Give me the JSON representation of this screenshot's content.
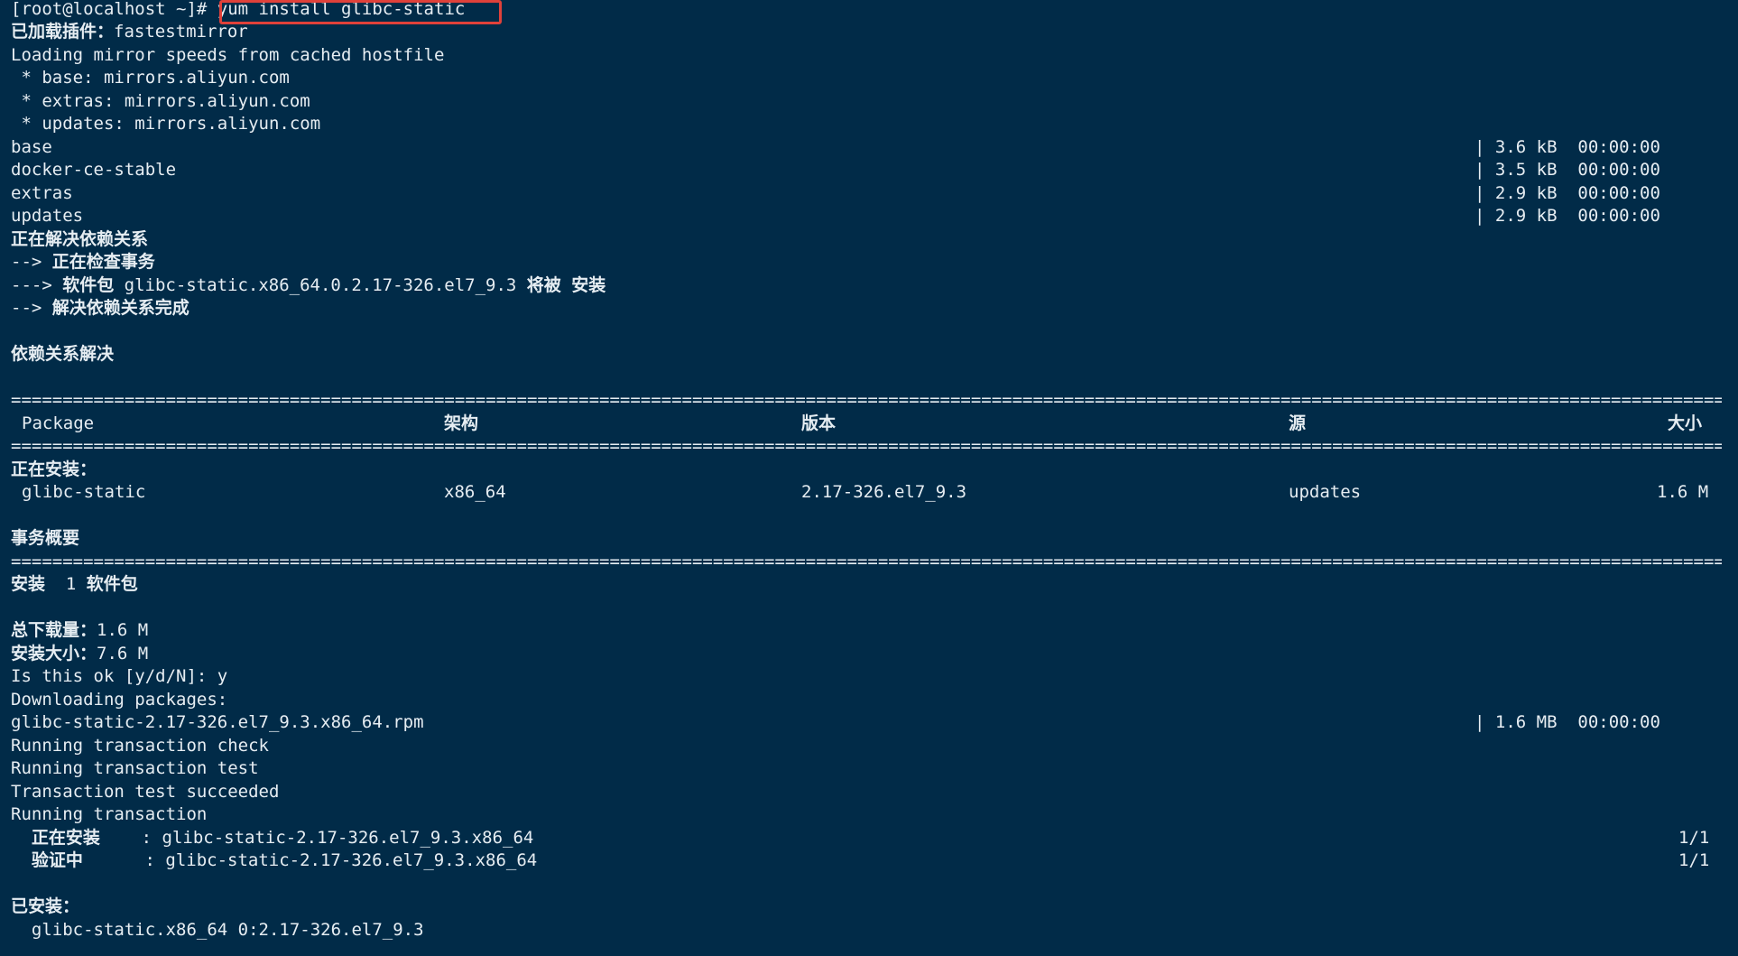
{
  "prompt": {
    "text": "[root@localhost ~]# ",
    "command": "yum install glibc-static"
  },
  "output": {
    "plugins_label": "已加载插件：",
    "plugins_value": "fastestmirror",
    "lines": [
      "Loading mirror speeds from cached hostfile",
      " * base: mirrors.aliyun.com",
      " * extras: mirrors.aliyun.com",
      " * updates: mirrors.aliyun.com"
    ]
  },
  "repos": [
    {
      "name": "base",
      "stats": "| 3.6 kB  00:00:00"
    },
    {
      "name": "docker-ce-stable",
      "stats": "| 3.5 kB  00:00:00"
    },
    {
      "name": "extras",
      "stats": "| 2.9 kB  00:00:00"
    },
    {
      "name": "updates",
      "stats": "| 2.9 kB  00:00:00"
    }
  ],
  "resolve": {
    "lines": {
      "0": "正在解决依赖关系",
      "1a": "--> ",
      "1b": "正在检查事务",
      "2a": "---> ",
      "2b": "软件包 ",
      "2c": "glibc-static.x86_64.0.2.17-326.el7_9.3 ",
      "2d": "将被 安装",
      "3a": "--> ",
      "3b": "解决依赖关系完成"
    },
    "heading": "依赖关系解决"
  },
  "table": {
    "divider": "===================================================================================================================================================================================",
    "headers": [
      "Package",
      "架构",
      "版本",
      "源",
      "大小"
    ],
    "group_label": "正在安装：",
    "rows": [
      [
        "glibc-static",
        "x86_64",
        "2.17-326.el7_9.3",
        "updates",
        "1.6 M"
      ]
    ]
  },
  "summary": {
    "heading": "事务概要",
    "install_a": "安装  ",
    "install_b": "1 ",
    "install_c": "软件包",
    "download_label": "总下载量：",
    "download_value": "1.6 M",
    "size_label": "安装大小：",
    "size_value": "7.6 M"
  },
  "run": {
    "lines": [
      "Is this ok [y/d/N]: y",
      "Downloading packages:",
      "Running transaction check",
      "Running transaction test",
      "Transaction test succeeded",
      "Running transaction"
    ],
    "rpm_name": "glibc-static-2.17-326.el7_9.3.x86_64.rpm",
    "rpm_stats": "| 1.6 MB  00:00:00",
    "steps": [
      {
        "label": "  正在安装    ",
        "detail": ": glibc-static-2.17-326.el7_9.3.x86_64",
        "progress": "1/1"
      },
      {
        "label": "  验证中      ",
        "detail": ": glibc-static-2.17-326.el7_9.3.x86_64",
        "progress": "1/1"
      }
    ]
  },
  "installed": {
    "heading": "已安装：",
    "package": "  glibc-static.x86_64 0:2.17-326.el7_9.3"
  }
}
